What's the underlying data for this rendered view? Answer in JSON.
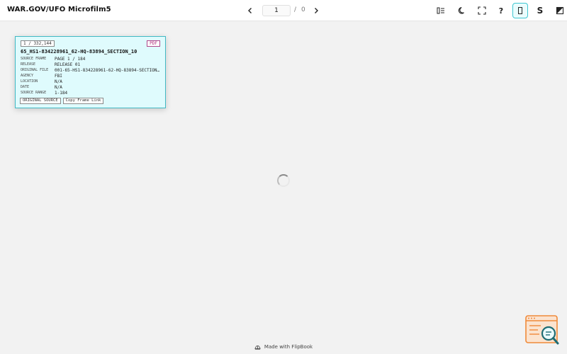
{
  "header": {
    "title": "WAR.GOV/UFO Microfilm5",
    "page_current": "1",
    "page_separator": "/",
    "page_total": "0"
  },
  "toolbar": {
    "s_label": "S",
    "help_label": "?"
  },
  "card": {
    "counter": "1 / 332,144",
    "pdf_label": "PDF",
    "file_name": "65_HS1-834228961_62-HQ-83894_SECTION_10",
    "meta": [
      {
        "key": "SOURCE FRAME",
        "value": "PAGE 1 / 184"
      },
      {
        "key": "RELEASE",
        "value": "RELEASE 01"
      },
      {
        "key": "ORIGINAL FILE",
        "value": "001-65-HS1-834228961-62-HQ-83894-SECTION…"
      },
      {
        "key": "AGENCY",
        "value": "FBI"
      },
      {
        "key": "LOCATION",
        "value": "N/A"
      },
      {
        "key": "DATE",
        "value": "N/A"
      },
      {
        "key": "SOURCE RANGE",
        "value": "1-184"
      }
    ],
    "original_source_label": "ORIGINAL SOURCE",
    "copy_link_label": "Copy Frame Link"
  },
  "footer": {
    "text": "Made with FlipBook"
  },
  "colors": {
    "accent": "#3dc6d1",
    "card_bg": "#dffbfd",
    "pdf": "#b0287a",
    "widget": "#f08a3a"
  }
}
